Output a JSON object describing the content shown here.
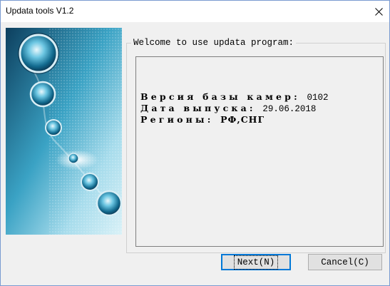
{
  "window": {
    "title": "Updata tools V1.2",
    "close_glyph": "✕"
  },
  "panel": {
    "legend": "Welcome to use updata program:",
    "lines": [
      {
        "label": "Версия базы камер:",
        "value": "0102",
        "value_bold": false
      },
      {
        "label": "Дата выпуска:",
        "value": "29.06.2018",
        "value_bold": false
      },
      {
        "label": "Регионы:",
        "value": "РФ,СНГ",
        "value_bold": true
      }
    ]
  },
  "buttons": {
    "next_label": "Next(N)",
    "cancel_label": "Cancel(C)"
  },
  "sidebar": {
    "image_icon": "chrome-balls-graphic",
    "colors": {
      "bg_dark": "#0e4e6e",
      "bg_light": "#bfe6f0",
      "accent": "#7fd3ec"
    }
  }
}
